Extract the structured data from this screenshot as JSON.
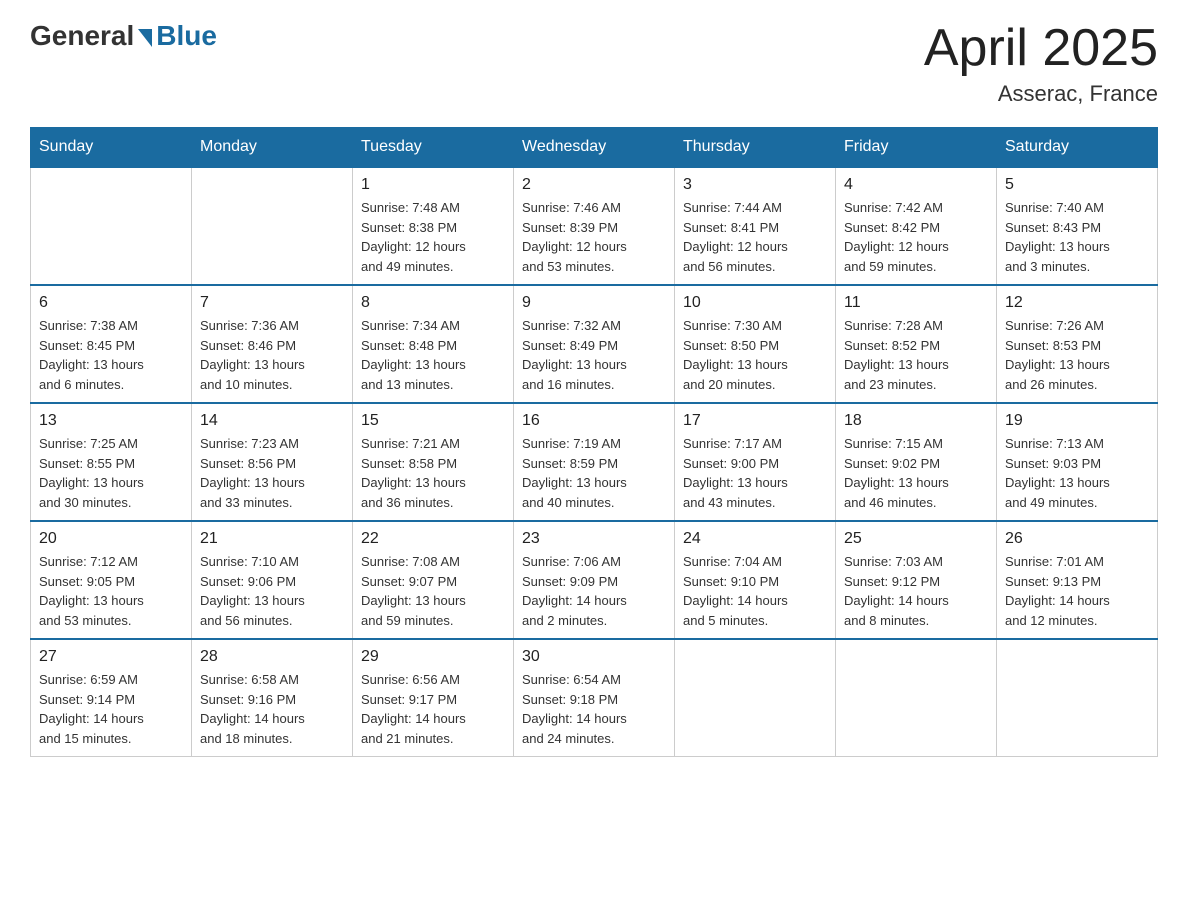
{
  "header": {
    "logo_general": "General",
    "logo_blue": "Blue",
    "month_year": "April 2025",
    "location": "Asserac, France"
  },
  "days_of_week": [
    "Sunday",
    "Monday",
    "Tuesday",
    "Wednesday",
    "Thursday",
    "Friday",
    "Saturday"
  ],
  "weeks": [
    [
      {
        "day": "",
        "info": ""
      },
      {
        "day": "",
        "info": ""
      },
      {
        "day": "1",
        "info": "Sunrise: 7:48 AM\nSunset: 8:38 PM\nDaylight: 12 hours\nand 49 minutes."
      },
      {
        "day": "2",
        "info": "Sunrise: 7:46 AM\nSunset: 8:39 PM\nDaylight: 12 hours\nand 53 minutes."
      },
      {
        "day": "3",
        "info": "Sunrise: 7:44 AM\nSunset: 8:41 PM\nDaylight: 12 hours\nand 56 minutes."
      },
      {
        "day": "4",
        "info": "Sunrise: 7:42 AM\nSunset: 8:42 PM\nDaylight: 12 hours\nand 59 minutes."
      },
      {
        "day": "5",
        "info": "Sunrise: 7:40 AM\nSunset: 8:43 PM\nDaylight: 13 hours\nand 3 minutes."
      }
    ],
    [
      {
        "day": "6",
        "info": "Sunrise: 7:38 AM\nSunset: 8:45 PM\nDaylight: 13 hours\nand 6 minutes."
      },
      {
        "day": "7",
        "info": "Sunrise: 7:36 AM\nSunset: 8:46 PM\nDaylight: 13 hours\nand 10 minutes."
      },
      {
        "day": "8",
        "info": "Sunrise: 7:34 AM\nSunset: 8:48 PM\nDaylight: 13 hours\nand 13 minutes."
      },
      {
        "day": "9",
        "info": "Sunrise: 7:32 AM\nSunset: 8:49 PM\nDaylight: 13 hours\nand 16 minutes."
      },
      {
        "day": "10",
        "info": "Sunrise: 7:30 AM\nSunset: 8:50 PM\nDaylight: 13 hours\nand 20 minutes."
      },
      {
        "day": "11",
        "info": "Sunrise: 7:28 AM\nSunset: 8:52 PM\nDaylight: 13 hours\nand 23 minutes."
      },
      {
        "day": "12",
        "info": "Sunrise: 7:26 AM\nSunset: 8:53 PM\nDaylight: 13 hours\nand 26 minutes."
      }
    ],
    [
      {
        "day": "13",
        "info": "Sunrise: 7:25 AM\nSunset: 8:55 PM\nDaylight: 13 hours\nand 30 minutes."
      },
      {
        "day": "14",
        "info": "Sunrise: 7:23 AM\nSunset: 8:56 PM\nDaylight: 13 hours\nand 33 minutes."
      },
      {
        "day": "15",
        "info": "Sunrise: 7:21 AM\nSunset: 8:58 PM\nDaylight: 13 hours\nand 36 minutes."
      },
      {
        "day": "16",
        "info": "Sunrise: 7:19 AM\nSunset: 8:59 PM\nDaylight: 13 hours\nand 40 minutes."
      },
      {
        "day": "17",
        "info": "Sunrise: 7:17 AM\nSunset: 9:00 PM\nDaylight: 13 hours\nand 43 minutes."
      },
      {
        "day": "18",
        "info": "Sunrise: 7:15 AM\nSunset: 9:02 PM\nDaylight: 13 hours\nand 46 minutes."
      },
      {
        "day": "19",
        "info": "Sunrise: 7:13 AM\nSunset: 9:03 PM\nDaylight: 13 hours\nand 49 minutes."
      }
    ],
    [
      {
        "day": "20",
        "info": "Sunrise: 7:12 AM\nSunset: 9:05 PM\nDaylight: 13 hours\nand 53 minutes."
      },
      {
        "day": "21",
        "info": "Sunrise: 7:10 AM\nSunset: 9:06 PM\nDaylight: 13 hours\nand 56 minutes."
      },
      {
        "day": "22",
        "info": "Sunrise: 7:08 AM\nSunset: 9:07 PM\nDaylight: 13 hours\nand 59 minutes."
      },
      {
        "day": "23",
        "info": "Sunrise: 7:06 AM\nSunset: 9:09 PM\nDaylight: 14 hours\nand 2 minutes."
      },
      {
        "day": "24",
        "info": "Sunrise: 7:04 AM\nSunset: 9:10 PM\nDaylight: 14 hours\nand 5 minutes."
      },
      {
        "day": "25",
        "info": "Sunrise: 7:03 AM\nSunset: 9:12 PM\nDaylight: 14 hours\nand 8 minutes."
      },
      {
        "day": "26",
        "info": "Sunrise: 7:01 AM\nSunset: 9:13 PM\nDaylight: 14 hours\nand 12 minutes."
      }
    ],
    [
      {
        "day": "27",
        "info": "Sunrise: 6:59 AM\nSunset: 9:14 PM\nDaylight: 14 hours\nand 15 minutes."
      },
      {
        "day": "28",
        "info": "Sunrise: 6:58 AM\nSunset: 9:16 PM\nDaylight: 14 hours\nand 18 minutes."
      },
      {
        "day": "29",
        "info": "Sunrise: 6:56 AM\nSunset: 9:17 PM\nDaylight: 14 hours\nand 21 minutes."
      },
      {
        "day": "30",
        "info": "Sunrise: 6:54 AM\nSunset: 9:18 PM\nDaylight: 14 hours\nand 24 minutes."
      },
      {
        "day": "",
        "info": ""
      },
      {
        "day": "",
        "info": ""
      },
      {
        "day": "",
        "info": ""
      }
    ]
  ]
}
